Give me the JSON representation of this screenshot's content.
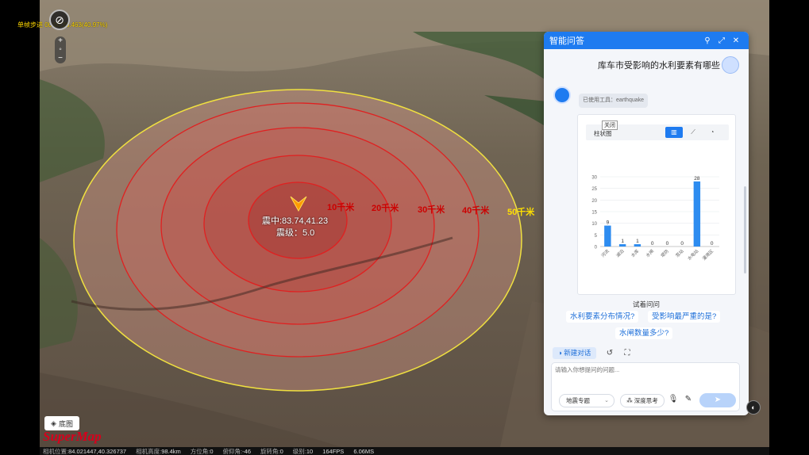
{
  "map": {
    "sim_step": "单帧步进 00:00:26.463(40.97%)",
    "ring_labels": [
      "10千米",
      "20千米",
      "30千米",
      "40千米",
      "50千米"
    ],
    "epicenter": "震中:83.74,41.23",
    "magnitude": "震级：5.0",
    "basemap_label": "底图",
    "logo": "SuperMap"
  },
  "status": {
    "camera_pos_label": "相机位置:",
    "camera_pos": "84.021447,40.326737",
    "camera_height_label": "相机高度:",
    "camera_height": "98.4km",
    "heading_label": "方位角:",
    "heading": "0",
    "pitch_label": "俯仰角:",
    "pitch": "-46",
    "roll_label": "旋转角:",
    "roll": "0",
    "level_label": "级别:",
    "level": "10",
    "fps": "164FPS",
    "ms": "6.06MS"
  },
  "panel": {
    "title": "智能问答",
    "user_question": "库车市受影响的水利要素有哪些",
    "tool_tag": "已使用工具：earthquake",
    "close_tip": "关闭",
    "chart_type_label": "柱状图",
    "suggest_title": "试着问问",
    "suggestions": [
      "水利要素分布情况?",
      "受影响最严重的是?",
      "水闸数量多少?"
    ],
    "new_chat": "新建对话",
    "input_placeholder": "请输入你想提问的问题...",
    "topic_select": "地震专题",
    "deep_think": "深度思考"
  },
  "colors": {
    "accent": "#1e7bf0",
    "bar": "#2d8cf0",
    "ring_red": "#e02020",
    "ring_yellow": "#f0e040"
  },
  "chart_data": {
    "type": "bar",
    "categories": [
      "河流",
      "湖泊",
      "水库",
      "水闸",
      "堤防",
      "泵站",
      "水电站",
      "灌溉区"
    ],
    "values": [
      9,
      1,
      1,
      0,
      0,
      0,
      28,
      0
    ],
    "ylim": [
      0,
      30
    ],
    "yticks": [
      0,
      5,
      10,
      15,
      20,
      25,
      30
    ],
    "grid": true
  }
}
